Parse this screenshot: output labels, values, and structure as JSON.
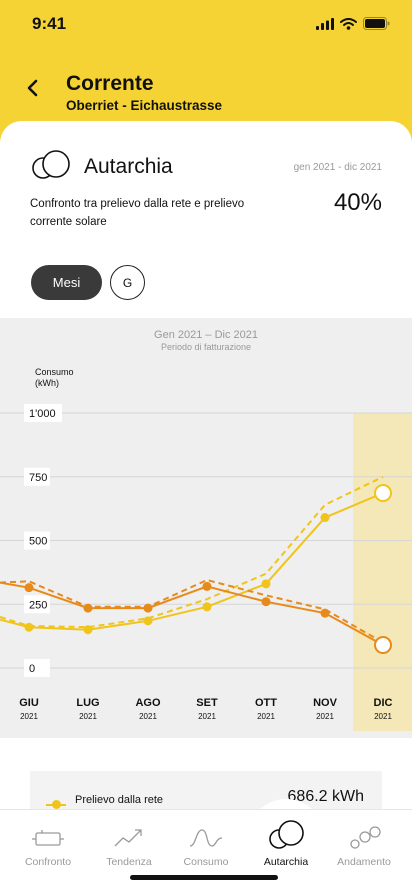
{
  "status": {
    "time": "9:41"
  },
  "header": {
    "title": "Corrente",
    "subtitle": "Oberriet - Eichaustrasse"
  },
  "card": {
    "icon": "autarchy-circles-icon",
    "title": "Autarchia",
    "period": "gen 2021 - dic 2021",
    "description": "Confronto tra prelievo dalla rete e prelievo corrente solare",
    "value": "40%"
  },
  "toggle": {
    "months_label": "Mesi",
    "days_label": "G",
    "selected": "Mesi"
  },
  "chart": {
    "title": "Gen 2021 – Dic 2021",
    "subtitle": "Periodo di fatturazione",
    "ylabel": [
      "Consumo",
      "(kWh)"
    ],
    "ytick_labels": [
      "1'000",
      "750",
      "500",
      "250",
      "0"
    ],
    "months": [
      {
        "label": "GIU",
        "year": "2021"
      },
      {
        "label": "LUG",
        "year": "2021"
      },
      {
        "label": "AGO",
        "year": "2021"
      },
      {
        "label": "SET",
        "year": "2021"
      },
      {
        "label": "OTT",
        "year": "2021"
      },
      {
        "label": "NOV",
        "year": "2021"
      },
      {
        "label": "DIC",
        "year": "2021"
      }
    ]
  },
  "chart_data": {
    "type": "line",
    "categories": [
      "GIU",
      "LUG",
      "AGO",
      "SET",
      "OTT",
      "NOV",
      "DIC"
    ],
    "ylim": [
      0,
      1000
    ],
    "yticks": [
      0,
      250,
      500,
      750,
      1000
    ],
    "grid": true,
    "highlighted_category": "DIC",
    "series": [
      {
        "style": "solid",
        "color": "#f0c419",
        "values": [
          160,
          150,
          185,
          240,
          330,
          590,
          686.2
        ],
        "left_edge": 190
      },
      {
        "style": "dashed",
        "color": "#f0c419",
        "values": [
          165,
          160,
          195,
          270,
          370,
          640,
          750
        ],
        "left_edge": 200
      },
      {
        "style": "solid",
        "color": "#e88a1a",
        "values": [
          315,
          235,
          235,
          320,
          260,
          215,
          90
        ],
        "left_edge": 335
      },
      {
        "style": "dashed",
        "color": "#e88a1a",
        "values": [
          340,
          240,
          240,
          345,
          285,
          230,
          100
        ],
        "left_edge": 335
      }
    ]
  },
  "legend": {
    "items": [
      {
        "label": "Prelievo dalla rete",
        "value": "686.2 kWh",
        "color": "#f0c419"
      }
    ]
  },
  "nav": {
    "items": [
      {
        "label": "Confronto",
        "icon": "battery-icon"
      },
      {
        "label": "Tendenza",
        "icon": "trend-arrow-icon"
      },
      {
        "label": "Consumo",
        "icon": "wave-icon"
      },
      {
        "label": "Autarchia",
        "icon": "autarchy-circles-icon"
      },
      {
        "label": "Andamento",
        "icon": "bubbles-icon"
      }
    ],
    "active": "Autarchia"
  }
}
